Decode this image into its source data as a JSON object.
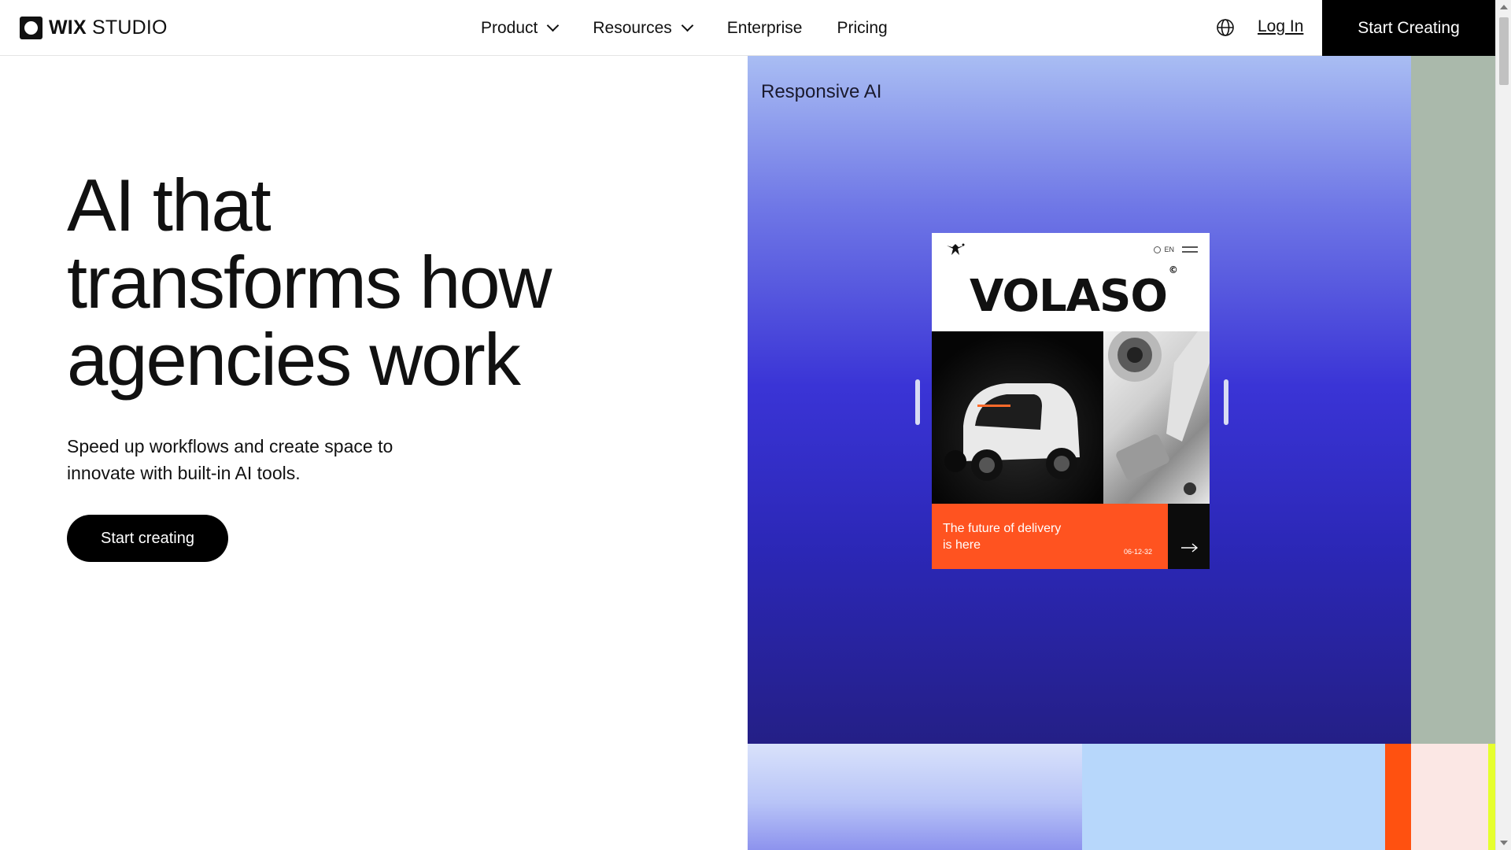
{
  "header": {
    "logo": {
      "wix": "WIX",
      "studio": "STUDIO"
    },
    "nav": [
      {
        "label": "Product",
        "has_dropdown": true
      },
      {
        "label": "Resources",
        "has_dropdown": true
      },
      {
        "label": "Enterprise",
        "has_dropdown": false
      },
      {
        "label": "Pricing",
        "has_dropdown": false
      }
    ],
    "language_icon": "globe-icon",
    "login_label": "Log In",
    "cta_label": "Start Creating"
  },
  "hero": {
    "title_lines": [
      "AI that",
      "transforms how",
      "agencies work"
    ],
    "subtitle": "Speed up workflows and create space to innovate with built-in AI tools.",
    "cta_label": "Start creating"
  },
  "showcase": {
    "label": "Responsive AI",
    "card": {
      "brand": "VOLASO",
      "brand_mark": "©",
      "language": "EN",
      "footer_text_line1": "The future of delivery",
      "footer_text_line2": "is here",
      "date": "06-12-32"
    }
  },
  "colors": {
    "accent_black": "#000000",
    "panel_blue": "#3a34d6",
    "card_orange": "#ff5320",
    "side_green": "#aab9ab"
  }
}
